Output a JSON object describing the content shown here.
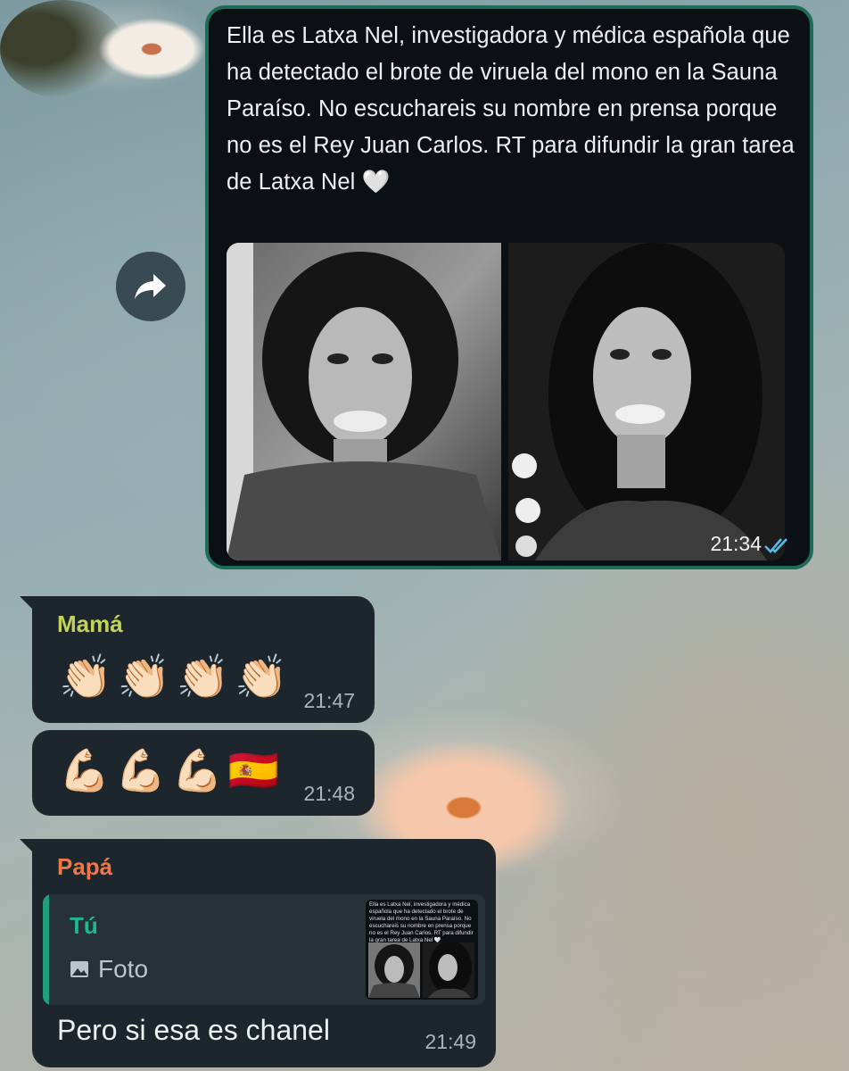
{
  "outgoing_message": {
    "text": "Ella es Latxa Nel, investigadora y médica española que ha detectado el brote de viruela del mono en la Sauna Paraíso. No escuchareis su nombre en prensa porque no es el Rey Juan Carlos. RT para difundir la gran tarea de Latxa Nel",
    "heart_emoji": "🤍",
    "time": "21:34",
    "status_icon": "double-check-read-icon",
    "images": [
      "portrait-left",
      "portrait-right"
    ]
  },
  "forward_button": {
    "icon": "forward-arrow-icon"
  },
  "messages": [
    {
      "sender": "Mamá",
      "emojis": [
        "👏🏻",
        "👏🏻",
        "👏🏻",
        "👏🏻"
      ],
      "time": "21:47"
    },
    {
      "emojis": [
        "💪🏻",
        "💪🏻",
        "💪🏻",
        "🇪🇸"
      ],
      "time": "21:48"
    },
    {
      "sender": "Papá",
      "quoted": {
        "author": "Tú",
        "type_label": "Foto",
        "thumbnail_text": "Ella es Latxa Nel, investigadora y médica española que ha detectado el brote de viruela del mono en la Sauna Paraíso. No escuchareis su nombre en prensa porque no es el Rey Juan Carlos. RT para difundir la gran tarea de Latxa Nel 🤍"
      },
      "text": "Pero si esa es chanel",
      "time": "21:49"
    }
  ],
  "colors": {
    "outgoing_border": "#1e6b58",
    "incoming_bg": "#1d262c",
    "mama_name": "#c3d35a",
    "papa_name": "#f07848",
    "quote_accent": "#1f9f7e",
    "read_check": "#53bdeb"
  }
}
